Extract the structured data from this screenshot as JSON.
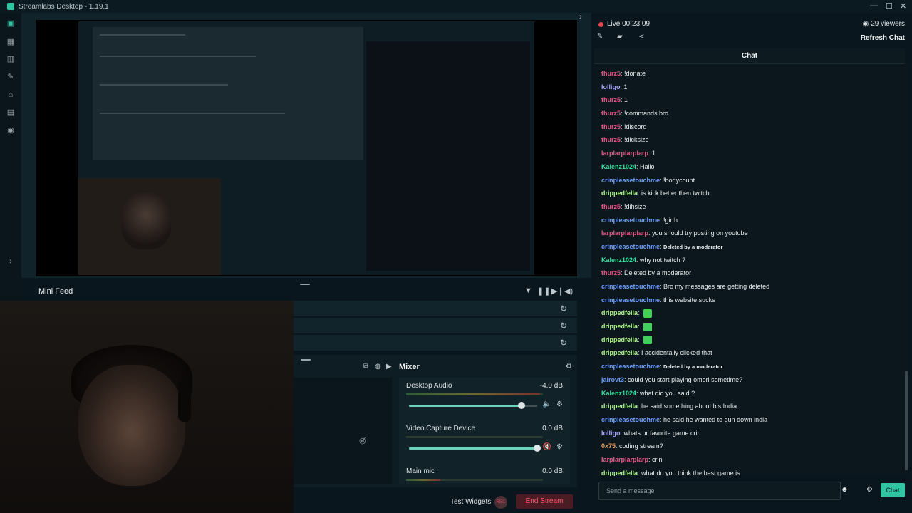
{
  "app": {
    "title": "Streamlabs Desktop - 1.19.1",
    "window_controls": [
      "—",
      "☐",
      "✕"
    ]
  },
  "leftnav": {
    "items": [
      "editor-icon",
      "dashboard-icon",
      "layouts-icon",
      "themes-icon",
      "store-icon",
      "media-icon",
      "record-icon"
    ]
  },
  "editor": {
    "mini_feed_label": "Mini Feed"
  },
  "scenes": {
    "rows": 3
  },
  "mixer": {
    "title": "Mixer",
    "channels": [
      {
        "name": "Desktop Audio",
        "db": "-4.0 dB",
        "level": 0.88
      },
      {
        "name": "Video Capture Device",
        "db": "0.0 dB",
        "level": 1.0
      },
      {
        "name": "Main mic",
        "db": "0.0 dB",
        "level": 0.25
      }
    ]
  },
  "footer": {
    "test_widgets": "Test Widgets",
    "rec": "REC",
    "end_stream": "End Stream"
  },
  "stream": {
    "live": "Live 00:23:09",
    "viewers": "29 viewers",
    "refresh_chat": "Refresh Chat"
  },
  "chat": {
    "header": "Chat",
    "input_placeholder": "Send a message",
    "send_label": "Chat",
    "messages": [
      {
        "user": "thurz5",
        "color": "#e9588a",
        "text": "!donate"
      },
      {
        "user": "lolligo",
        "color": "#a6a6ff",
        "text": "1"
      },
      {
        "user": "thurz5",
        "color": "#e9588a",
        "text": "1"
      },
      {
        "user": "thurz5",
        "color": "#e9588a",
        "text": "!commands bro"
      },
      {
        "user": "thurz5",
        "color": "#e9588a",
        "text": "!discord"
      },
      {
        "user": "thurz5",
        "color": "#e9588a",
        "text": "!dicksize"
      },
      {
        "user": "larplarplarplarp",
        "color": "#e9588a",
        "text": "1"
      },
      {
        "user": "Kalenz1024",
        "color": "#32e09f",
        "text": "Hallo"
      },
      {
        "user": "crinpleasetouchme",
        "color": "#6c9fff",
        "text": "!bodycount"
      },
      {
        "user": "drippedfella",
        "color": "#aef58b",
        "text": "is kick better then twitch"
      },
      {
        "user": "thurz5",
        "color": "#e9588a",
        "text": "!dihsize"
      },
      {
        "user": "crinpleasetouchme",
        "color": "#6c9fff",
        "text": "!girth"
      },
      {
        "user": "larplarplarplarp",
        "color": "#e9588a",
        "text": "you should try posting on youtube"
      },
      {
        "user": "crinpleasetouchme",
        "color": "#6c9fff",
        "text": "Deleted by a moderator",
        "deleted": true
      },
      {
        "user": "Kalenz1024",
        "color": "#32e09f",
        "text": "why not twitch ?"
      },
      {
        "user": "thurz5",
        "color": "#e9588a",
        "text": "Deleted by a moderator"
      },
      {
        "user": "crinpleasetouchme",
        "color": "#6c9fff",
        "text": "Bro my messages are getting deleted"
      },
      {
        "user": "crinpleasetouchme",
        "color": "#6c9fff",
        "text": "this website sucks"
      },
      {
        "user": "drippedfella",
        "color": "#aef58b",
        "text": "",
        "emote": true
      },
      {
        "user": "drippedfella",
        "color": "#aef58b",
        "text": "",
        "emote": true
      },
      {
        "user": "drippedfella",
        "color": "#aef58b",
        "text": "",
        "emote": true
      },
      {
        "user": "drippedfella",
        "color": "#aef58b",
        "text": "I accidentally clicked that"
      },
      {
        "user": "crinpleasetouchme",
        "color": "#6c9fff",
        "text": "Deleted by a moderator",
        "deleted": true
      },
      {
        "user": "jairovt3",
        "color": "#6c9fff",
        "text": "could you start playing omori sometime?"
      },
      {
        "user": "Kalenz1024",
        "color": "#32e09f",
        "text": "what did you said ?"
      },
      {
        "user": "drippedfella",
        "color": "#aef58b",
        "text": "he said something about his India"
      },
      {
        "user": "crinpleasetouchme",
        "color": "#6c9fff",
        "text": "he said he wanted to gun down india"
      },
      {
        "user": "lolligo",
        "color": "#a6a6ff",
        "text": "whats ur favorite game crin"
      },
      {
        "user": "0x75",
        "color": "#f5a15a",
        "text": "coding stream?"
      },
      {
        "user": "larplarplarplarp",
        "color": "#e9588a",
        "text": "crin"
      },
      {
        "user": "drippedfella",
        "color": "#aef58b",
        "text": "what do you think the best game is"
      }
    ]
  }
}
